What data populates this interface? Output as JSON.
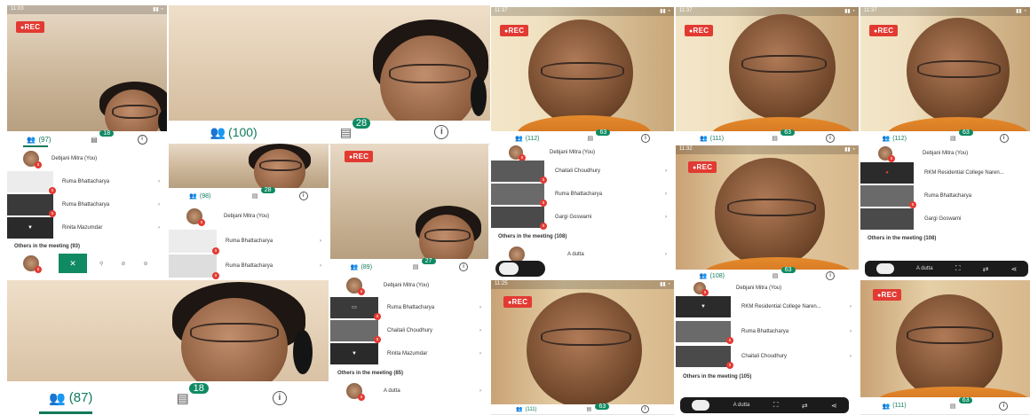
{
  "rec_label": "REC",
  "colors": {
    "accent": "#0f7a5a",
    "rec": "#e23a32",
    "badge": "#0f8a62"
  },
  "icons": {
    "participants": "participants-icon",
    "chat": "chat-icon",
    "info": "info-icon",
    "muted": "muted-mic-icon",
    "close": "close-icon",
    "camera": "camera-icon"
  },
  "s1": {
    "time": "11:03",
    "participants": "(97)",
    "chat_badge": "18",
    "rows": [
      "Debjani Mitra (You)",
      "Ruma Bhattacharya",
      "Ruma Bhattacharya",
      "Rinita Mazumdar"
    ],
    "others": "Others in the meeting (93)",
    "bottom_participants": "(87)",
    "bottom_chat": "18"
  },
  "s2": {
    "participants": "(100)",
    "chat_badge": "28"
  },
  "s3": {
    "participants": "(98)",
    "chat_badge": "28",
    "rows": [
      "Debjani Mitra (You)",
      "Ruma Bhattacharya",
      "Ruma Bhattacharya"
    ]
  },
  "s4": {
    "participants": "(89)",
    "chat_badge": "27",
    "rows": [
      "Debjani Mitra (You)",
      "Ruma Bhattacharya",
      "Chaitali Choudhury",
      "Rinita Mazumdar"
    ],
    "others": "Others in the meeting (85)",
    "other_rows": [
      "A dutta"
    ]
  },
  "s5": {
    "time": "11:37",
    "participants": "(112)",
    "chat_badge": "63",
    "rows": [
      "Debjani Mitra (You)",
      "Chaitali Choudhury",
      "Ruma Bhattacharya",
      "Gargi Goswami"
    ],
    "others": "Others in the meeting (108)",
    "other_rows": [
      "A dutta"
    ]
  },
  "s6": {
    "time": "11:37",
    "participants": "(111)",
    "chat_badge": "63"
  },
  "s7": {
    "time": "11:37",
    "participants": "(112)",
    "chat_badge": "63",
    "rows": [
      "Debjani Mitra (You)",
      "RKM Residential College Naren...",
      "Ruma Bhattacharya",
      "Gargi Goswami"
    ],
    "others": "Others in the meeting (108)",
    "other_rows": [
      "A dutta"
    ]
  },
  "s8": {
    "time": "11:32",
    "participants": "(108)",
    "chat_badge": "63",
    "rows": [
      "Debjani Mitra (You)",
      "RKM Residential College Naren...",
      "Ruma Bhattacharya",
      "Chaitali Choudhury"
    ],
    "others": "Others in the meeting (105)",
    "other_rows": [
      "A dutta"
    ]
  },
  "s9": {
    "time": "11:25",
    "participants": "(111)",
    "chat_badge": "63"
  },
  "s10": {
    "participants": "(111)",
    "chat_badge": "63"
  }
}
